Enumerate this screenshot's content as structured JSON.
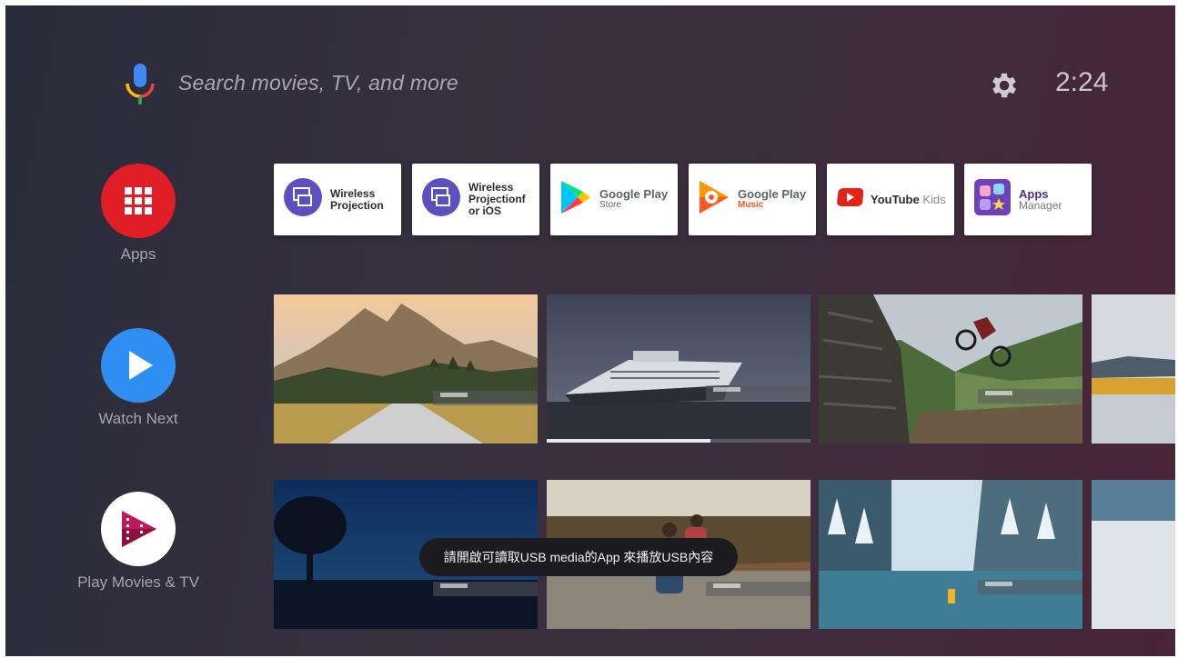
{
  "search": {
    "placeholder_text": "Search movies, TV, and more",
    "icon": "mic-icon"
  },
  "header": {
    "clock": "2:24",
    "settings_icon": "gear-icon"
  },
  "rail": {
    "apps_label": "Apps",
    "watch_next_label": "Watch Next",
    "play_movies_label": "Play Movies & TV"
  },
  "apps": [
    {
      "line1": "Wireless",
      "line2": "Projection",
      "line3": "",
      "icon": "wireless-projection-icon"
    },
    {
      "line1": "Wireless",
      "line2": "Projectionf",
      "line3": "or iOS",
      "icon": "wireless-projection-ios-icon"
    },
    {
      "line1": "Google Play",
      "sub": "Store",
      "icon": "google-play-store-icon"
    },
    {
      "line1": "Google Play",
      "sub": "Music",
      "icon": "google-play-music-icon"
    },
    {
      "line1": "YouTube",
      "line1b": "Kids",
      "icon": "youtube-kids-icon"
    },
    {
      "line1": "Apps",
      "sub": "Manager",
      "icon": "apps-manager-icon"
    }
  ],
  "watch_next": {
    "progress_fraction": 0.62
  },
  "toast": {
    "message": "請開啟可讀取USB media的App 來播放USB內容"
  },
  "colors": {
    "apps_red": "#e01e27",
    "watch_blue": "#2f8ef2",
    "play_movies_magenta": "#c2185b",
    "accent_text": "#2d2d2d"
  }
}
